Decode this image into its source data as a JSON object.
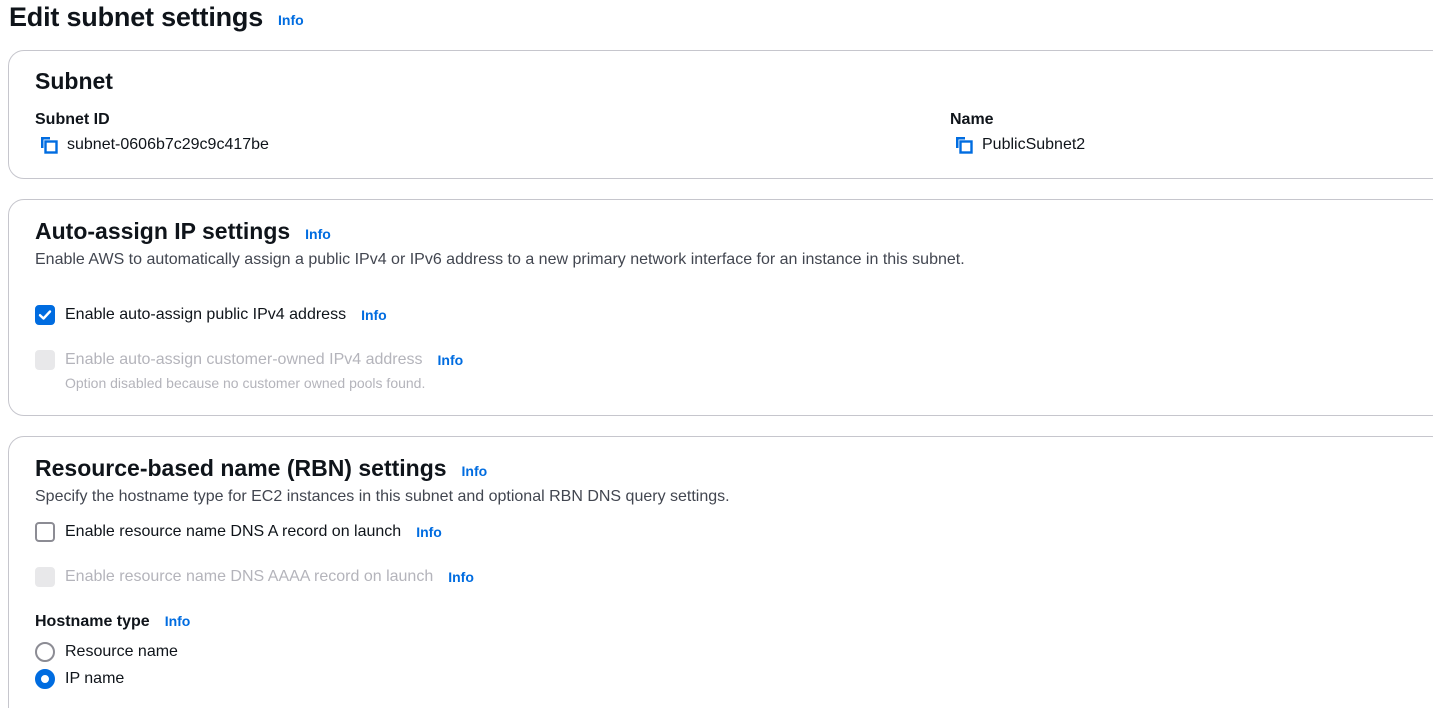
{
  "page": {
    "title": "Edit subnet settings",
    "info": "Info"
  },
  "colors": {
    "accent": "#006ce0",
    "text": "#0f141a",
    "muted": "#424650",
    "disabled": "#b4b4bb",
    "border": "#c6c6cd"
  },
  "subnet_section": {
    "title": "Subnet",
    "subnet_id_label": "Subnet ID",
    "subnet_id_value": "subnet-0606b7c29c9c417be",
    "name_label": "Name",
    "name_value": "PublicSubnet2",
    "copy_icon": "copy-icon"
  },
  "auto_assign": {
    "title": "Auto-assign IP settings",
    "info": "Info",
    "description": "Enable AWS to automatically assign a public IPv4 or IPv6 address to a new primary network interface for an instance in this subnet.",
    "ipv4": {
      "label": "Enable auto-assign public IPv4 address",
      "info": "Info",
      "checked": true
    },
    "customer_owned": {
      "label": "Enable auto-assign customer-owned IPv4 address",
      "info": "Info",
      "checked": false,
      "disabled": true,
      "note": "Option disabled because no customer owned pools found."
    }
  },
  "rbn": {
    "title": "Resource-based name (RBN) settings",
    "info": "Info",
    "description": "Specify the hostname type for EC2 instances in this subnet and optional RBN DNS query settings.",
    "dns_a": {
      "label": "Enable resource name DNS A record on launch",
      "info": "Info",
      "checked": false
    },
    "dns_aaaa": {
      "label": "Enable resource name DNS AAAA record on launch",
      "info": "Info",
      "checked": false,
      "disabled": true
    },
    "hostname_type": {
      "label": "Hostname type",
      "info": "Info",
      "options": [
        {
          "label": "Resource name",
          "selected": false
        },
        {
          "label": "IP name",
          "selected": true
        }
      ]
    }
  }
}
